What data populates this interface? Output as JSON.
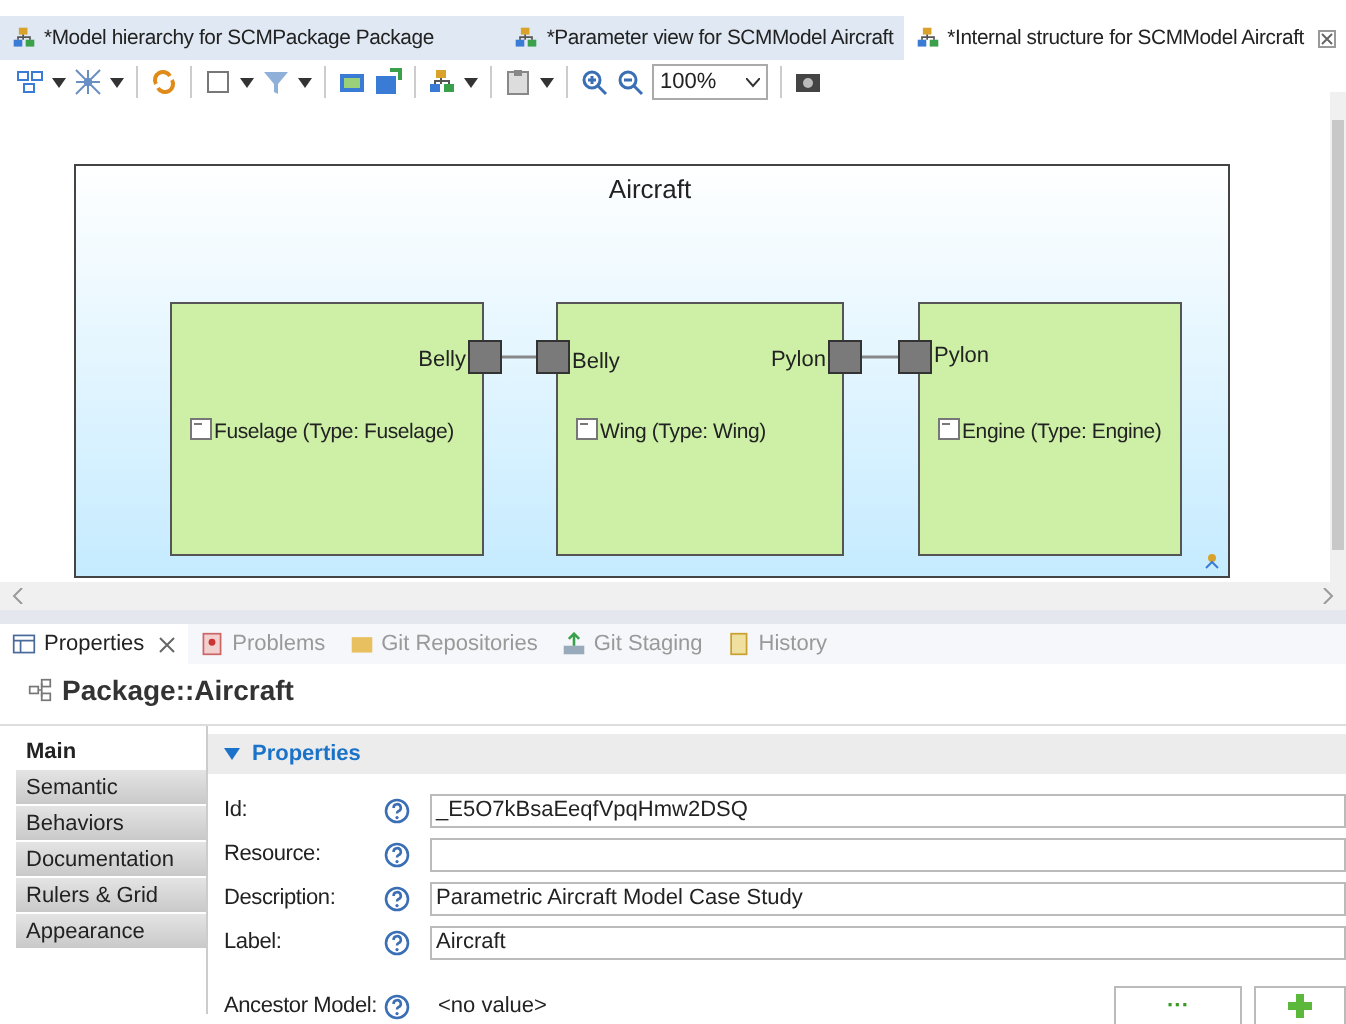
{
  "editor_tabs": [
    {
      "title": "*Model hierarchy for SCMPackage Package",
      "selected": false
    },
    {
      "title": "*Parameter view for SCMModel Aircraft",
      "selected": false
    },
    {
      "title": "*Internal structure for SCMModel Aircraft",
      "selected": true
    }
  ],
  "toolbar": {
    "zoom": "100%"
  },
  "diagram": {
    "container": "Aircraft",
    "parts": [
      {
        "label": "Fuselage (Type: Fuselage)",
        "right_port": "Belly"
      },
      {
        "label": "Wing (Type: Wing)",
        "left_port": "Belly",
        "right_port": "Pylon"
      },
      {
        "label": "Engine (Type: Engine)",
        "left_port": "Pylon"
      }
    ]
  },
  "view_tabs": [
    {
      "label": "Properties",
      "selected": true
    },
    {
      "label": "Problems",
      "selected": false
    },
    {
      "label": "Git Repositories",
      "selected": false
    },
    {
      "label": "Git Staging",
      "selected": false
    },
    {
      "label": "History",
      "selected": false
    }
  ],
  "properties": {
    "title": "Package::Aircraft",
    "side_tabs": [
      {
        "label": "Main",
        "selected": true
      },
      {
        "label": "Semantic",
        "selected": false
      },
      {
        "label": "Behaviors",
        "selected": false
      },
      {
        "label": "Documentation",
        "selected": false
      },
      {
        "label": "Rulers & Grid",
        "selected": false
      },
      {
        "label": "Appearance",
        "selected": false
      }
    ],
    "section": {
      "title": "Properties",
      "expanded": true
    },
    "fields": [
      {
        "kind": "text",
        "label": "Id:",
        "value": "_E5O7kBsaEeqfVpqHmw2DSQ"
      },
      {
        "kind": "text",
        "label": "Resource:"
      },
      {
        "kind": "text",
        "label": "Description:",
        "value": "Parametric Aircraft Model Case Study"
      },
      {
        "kind": "text",
        "label": "Label:",
        "value": "Aircraft"
      },
      {
        "kind": "reference",
        "label": "Ancestor Model:",
        "value": "<no value>",
        "browse": "···"
      }
    ]
  }
}
